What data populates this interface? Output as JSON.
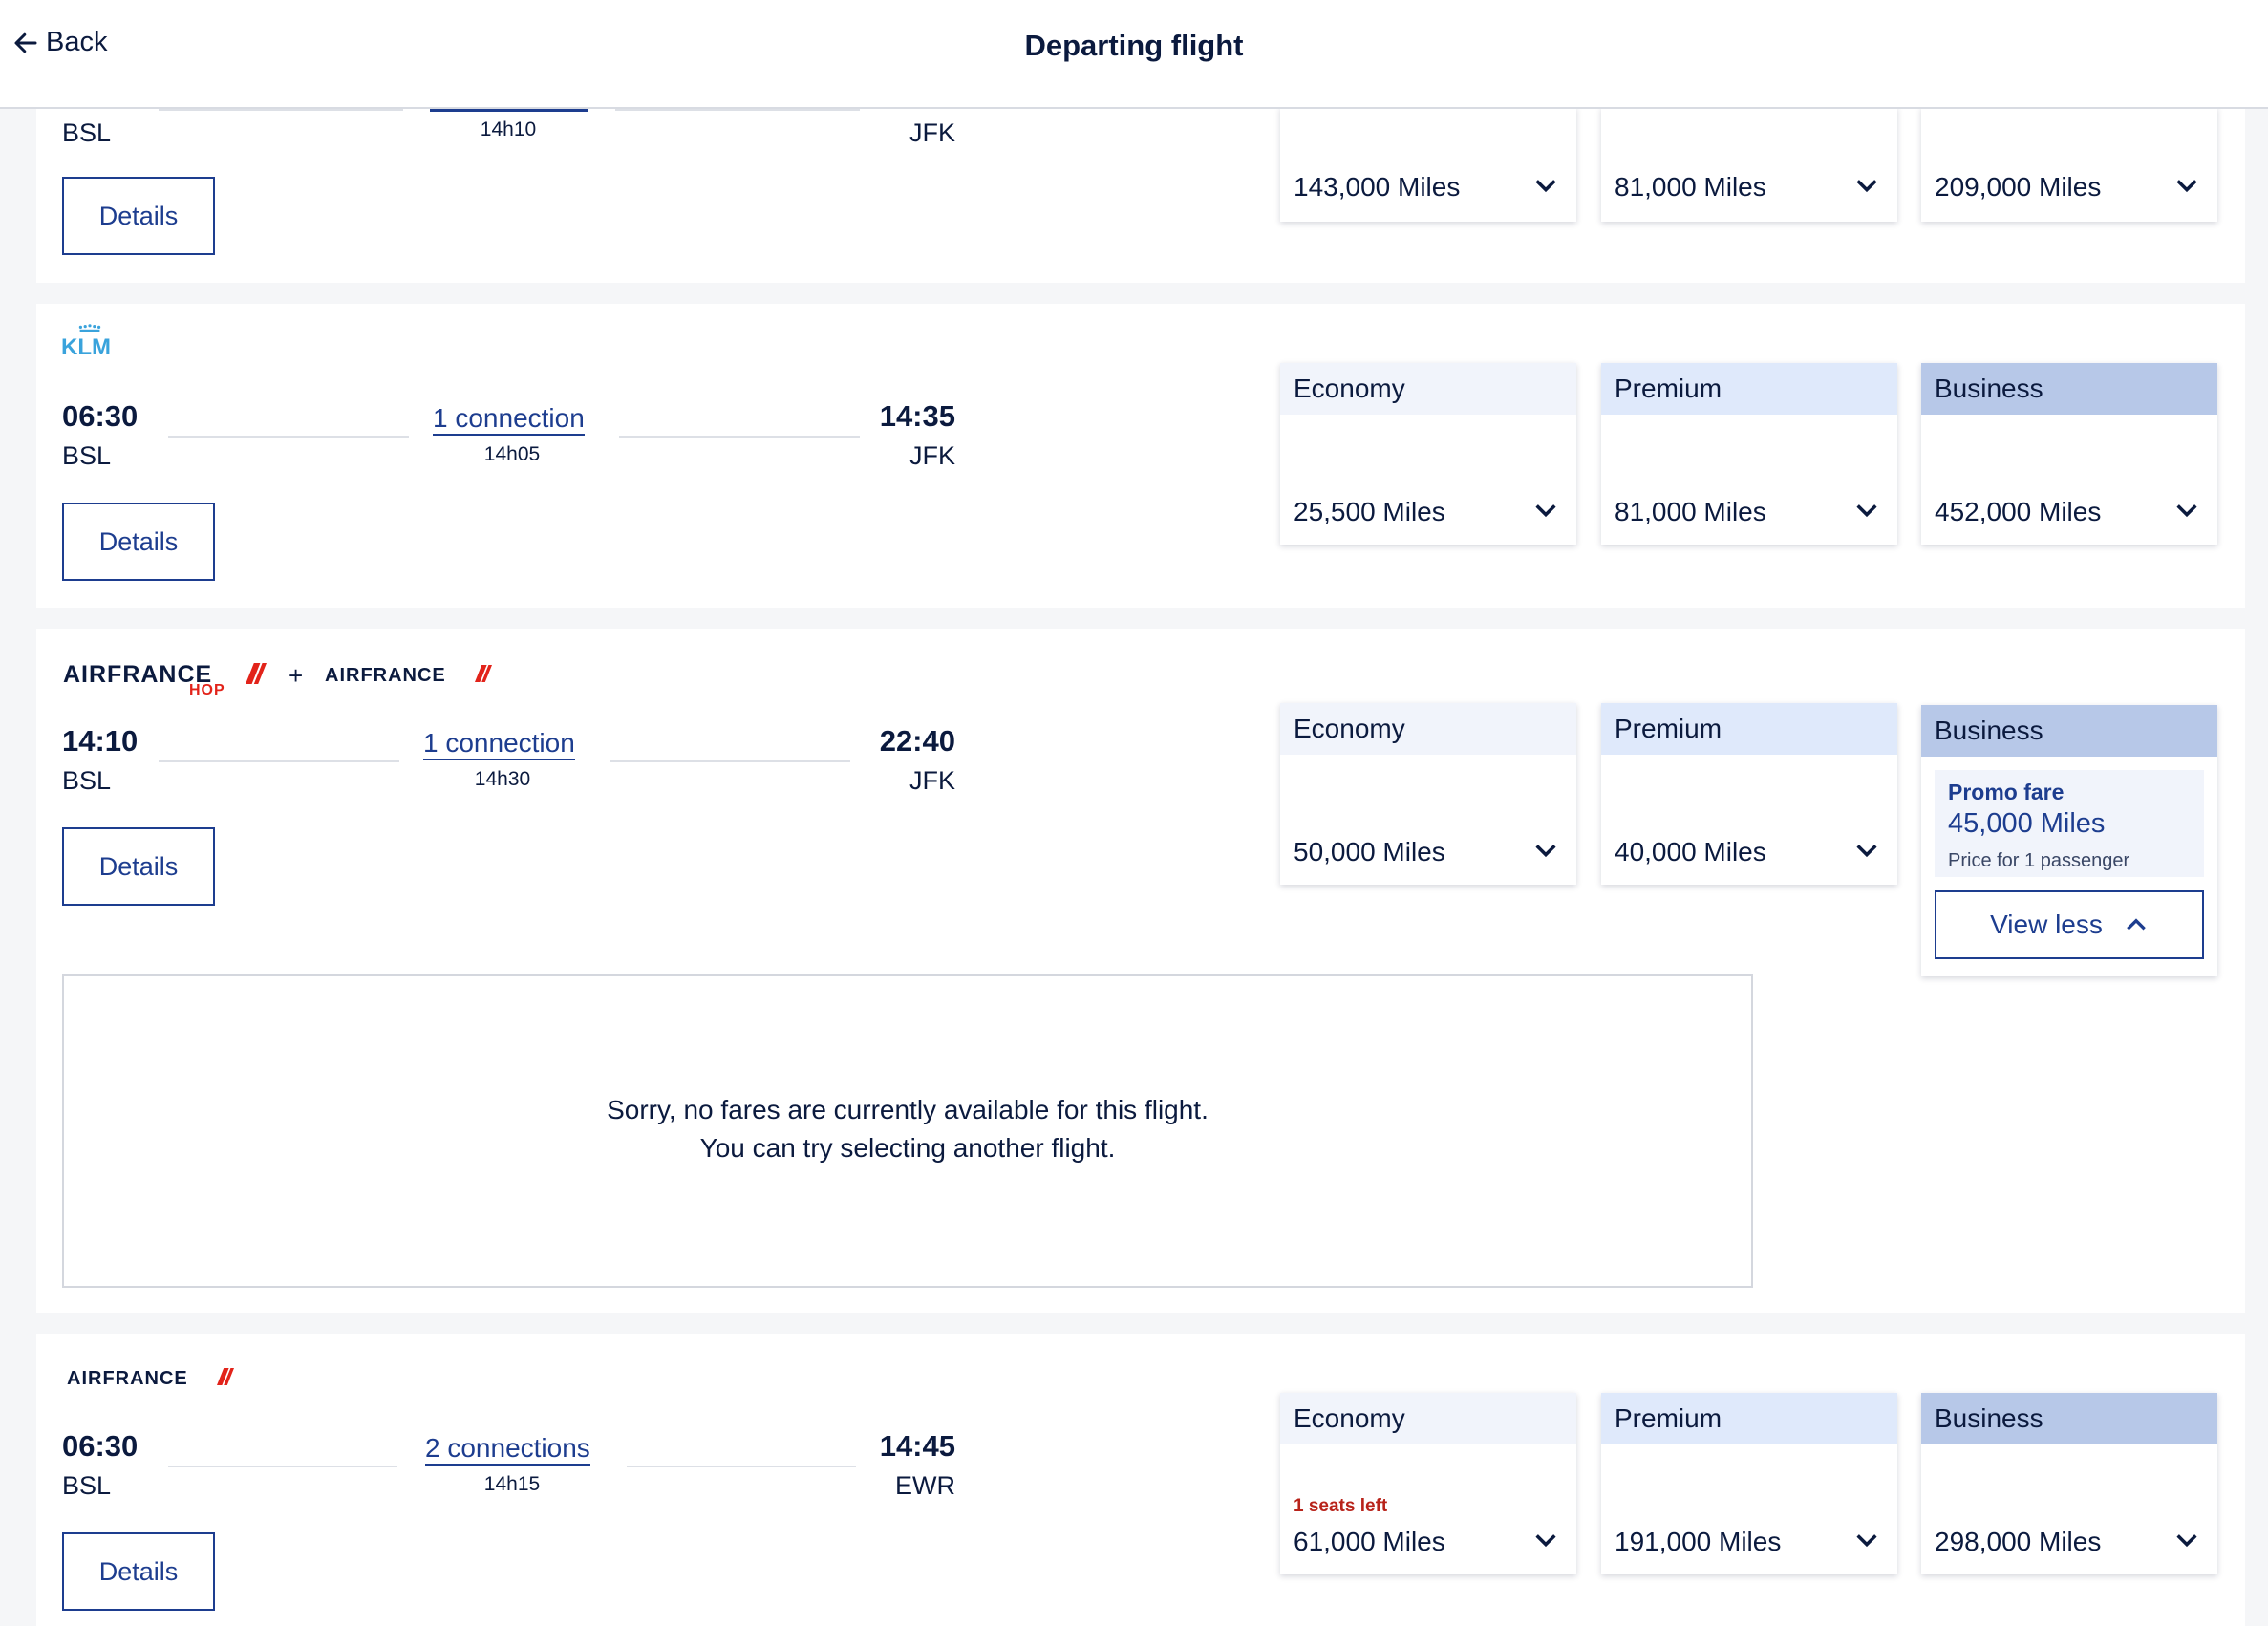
{
  "header": {
    "back_label": "Back",
    "title": "Departing flight"
  },
  "colors": {
    "navy": "#0b1a3e",
    "link": "#1d3d8f",
    "economy_header": "#f1f4fb",
    "premium_header": "#dfe9fb",
    "business_header": "#b7c8e8",
    "alert_red": "#b8231a",
    "af_red": "#e2231a",
    "klm_blue": "#3aa3dc"
  },
  "flights": [
    {
      "duration": "14h10",
      "origin": "BSL",
      "destination": "JFK",
      "details_label": "Details",
      "fares": {
        "economy": "143,000 Miles",
        "premium": "81,000 Miles",
        "business": "209,000 Miles"
      }
    },
    {
      "airline_logo": "klm-logo",
      "logo_text": "KLM",
      "dep_time": "06:30",
      "arr_time": "14:35",
      "connection": "1 connection",
      "duration": "14h05",
      "origin": "BSL",
      "destination": "JFK",
      "details_label": "Details",
      "fare_labels": {
        "economy": "Economy",
        "premium": "Premium",
        "business": "Business"
      },
      "fares": {
        "economy": "25,500 Miles",
        "premium": "81,000 Miles",
        "business": "452,000 Miles"
      }
    },
    {
      "airline_logo": "airfrance-hop-plus-airfrance-logo",
      "logo_text_1": "AIRFRANCE",
      "logo_sub": "HOP",
      "plus": "+",
      "logo_text_2": "AIRFRANCE",
      "dep_time": "14:10",
      "arr_time": "22:40",
      "connection": "1 connection",
      "duration": "14h30",
      "origin": "BSL",
      "destination": "JFK",
      "details_label": "Details",
      "fare_labels": {
        "economy": "Economy",
        "premium": "Premium",
        "business": "Business"
      },
      "fares": {
        "economy": "50,000 Miles",
        "premium": "40,000 Miles"
      },
      "business_expanded": {
        "promo_label": "Promo fare",
        "price": "45,000 Miles",
        "note": "Price for 1 passenger",
        "view_less_label": "View less"
      },
      "no_fares_line1": "Sorry, no fares are currently available for this flight.",
      "no_fares_line2": "You can try selecting another flight."
    },
    {
      "airline_logo": "airfrance-logo",
      "logo_text": "AIRFRANCE",
      "dep_time": "06:30",
      "arr_time": "14:45",
      "connection": "2 connections",
      "duration": "14h15",
      "origin": "BSL",
      "destination": "EWR",
      "details_label": "Details",
      "fare_labels": {
        "economy": "Economy",
        "premium": "Premium",
        "business": "Business"
      },
      "seats_left": "1 seats left",
      "fares": {
        "economy": "61,000 Miles",
        "premium": "191,000 Miles",
        "business": "298,000 Miles"
      }
    }
  ]
}
